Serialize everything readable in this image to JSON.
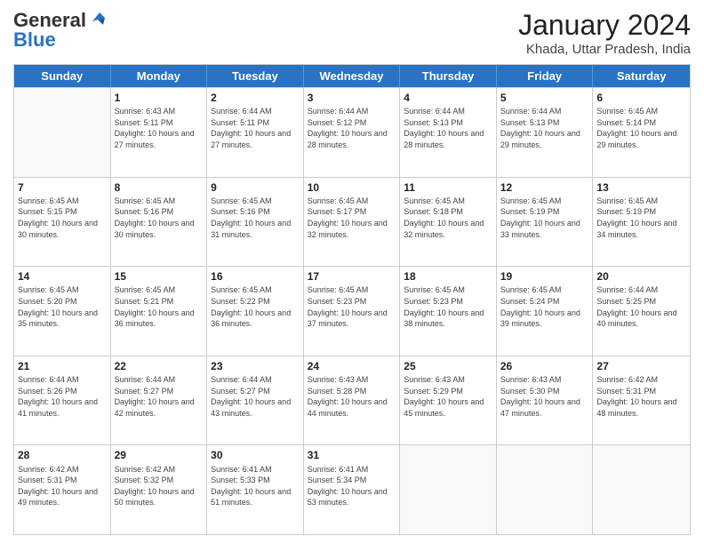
{
  "header": {
    "logo_general": "General",
    "logo_blue": "Blue",
    "month_year": "January 2024",
    "location": "Khada, Uttar Pradesh, India"
  },
  "calendar": {
    "days": [
      "Sunday",
      "Monday",
      "Tuesday",
      "Wednesday",
      "Thursday",
      "Friday",
      "Saturday"
    ],
    "weeks": [
      [
        {
          "day": "",
          "info": ""
        },
        {
          "day": "1",
          "info": "Sunrise: 6:43 AM\nSunset: 5:11 PM\nDaylight: 10 hours and 27 minutes."
        },
        {
          "day": "2",
          "info": "Sunrise: 6:44 AM\nSunset: 5:11 PM\nDaylight: 10 hours and 27 minutes."
        },
        {
          "day": "3",
          "info": "Sunrise: 6:44 AM\nSunset: 5:12 PM\nDaylight: 10 hours and 28 minutes."
        },
        {
          "day": "4",
          "info": "Sunrise: 6:44 AM\nSunset: 5:13 PM\nDaylight: 10 hours and 28 minutes."
        },
        {
          "day": "5",
          "info": "Sunrise: 6:44 AM\nSunset: 5:13 PM\nDaylight: 10 hours and 29 minutes."
        },
        {
          "day": "6",
          "info": "Sunrise: 6:45 AM\nSunset: 5:14 PM\nDaylight: 10 hours and 29 minutes."
        }
      ],
      [
        {
          "day": "7",
          "info": "Sunrise: 6:45 AM\nSunset: 5:15 PM\nDaylight: 10 hours and 30 minutes."
        },
        {
          "day": "8",
          "info": "Sunrise: 6:45 AM\nSunset: 5:16 PM\nDaylight: 10 hours and 30 minutes."
        },
        {
          "day": "9",
          "info": "Sunrise: 6:45 AM\nSunset: 5:16 PM\nDaylight: 10 hours and 31 minutes."
        },
        {
          "day": "10",
          "info": "Sunrise: 6:45 AM\nSunset: 5:17 PM\nDaylight: 10 hours and 32 minutes."
        },
        {
          "day": "11",
          "info": "Sunrise: 6:45 AM\nSunset: 5:18 PM\nDaylight: 10 hours and 32 minutes."
        },
        {
          "day": "12",
          "info": "Sunrise: 6:45 AM\nSunset: 5:19 PM\nDaylight: 10 hours and 33 minutes."
        },
        {
          "day": "13",
          "info": "Sunrise: 6:45 AM\nSunset: 5:19 PM\nDaylight: 10 hours and 34 minutes."
        }
      ],
      [
        {
          "day": "14",
          "info": "Sunrise: 6:45 AM\nSunset: 5:20 PM\nDaylight: 10 hours and 35 minutes."
        },
        {
          "day": "15",
          "info": "Sunrise: 6:45 AM\nSunset: 5:21 PM\nDaylight: 10 hours and 36 minutes."
        },
        {
          "day": "16",
          "info": "Sunrise: 6:45 AM\nSunset: 5:22 PM\nDaylight: 10 hours and 36 minutes."
        },
        {
          "day": "17",
          "info": "Sunrise: 6:45 AM\nSunset: 5:23 PM\nDaylight: 10 hours and 37 minutes."
        },
        {
          "day": "18",
          "info": "Sunrise: 6:45 AM\nSunset: 5:23 PM\nDaylight: 10 hours and 38 minutes."
        },
        {
          "day": "19",
          "info": "Sunrise: 6:45 AM\nSunset: 5:24 PM\nDaylight: 10 hours and 39 minutes."
        },
        {
          "day": "20",
          "info": "Sunrise: 6:44 AM\nSunset: 5:25 PM\nDaylight: 10 hours and 40 minutes."
        }
      ],
      [
        {
          "day": "21",
          "info": "Sunrise: 6:44 AM\nSunset: 5:26 PM\nDaylight: 10 hours and 41 minutes."
        },
        {
          "day": "22",
          "info": "Sunrise: 6:44 AM\nSunset: 5:27 PM\nDaylight: 10 hours and 42 minutes."
        },
        {
          "day": "23",
          "info": "Sunrise: 6:44 AM\nSunset: 5:27 PM\nDaylight: 10 hours and 43 minutes."
        },
        {
          "day": "24",
          "info": "Sunrise: 6:43 AM\nSunset: 5:28 PM\nDaylight: 10 hours and 44 minutes."
        },
        {
          "day": "25",
          "info": "Sunrise: 6:43 AM\nSunset: 5:29 PM\nDaylight: 10 hours and 45 minutes."
        },
        {
          "day": "26",
          "info": "Sunrise: 6:43 AM\nSunset: 5:30 PM\nDaylight: 10 hours and 47 minutes."
        },
        {
          "day": "27",
          "info": "Sunrise: 6:42 AM\nSunset: 5:31 PM\nDaylight: 10 hours and 48 minutes."
        }
      ],
      [
        {
          "day": "28",
          "info": "Sunrise: 6:42 AM\nSunset: 5:31 PM\nDaylight: 10 hours and 49 minutes."
        },
        {
          "day": "29",
          "info": "Sunrise: 6:42 AM\nSunset: 5:32 PM\nDaylight: 10 hours and 50 minutes."
        },
        {
          "day": "30",
          "info": "Sunrise: 6:41 AM\nSunset: 5:33 PM\nDaylight: 10 hours and 51 minutes."
        },
        {
          "day": "31",
          "info": "Sunrise: 6:41 AM\nSunset: 5:34 PM\nDaylight: 10 hours and 53 minutes."
        },
        {
          "day": "",
          "info": ""
        },
        {
          "day": "",
          "info": ""
        },
        {
          "day": "",
          "info": ""
        }
      ]
    ]
  }
}
